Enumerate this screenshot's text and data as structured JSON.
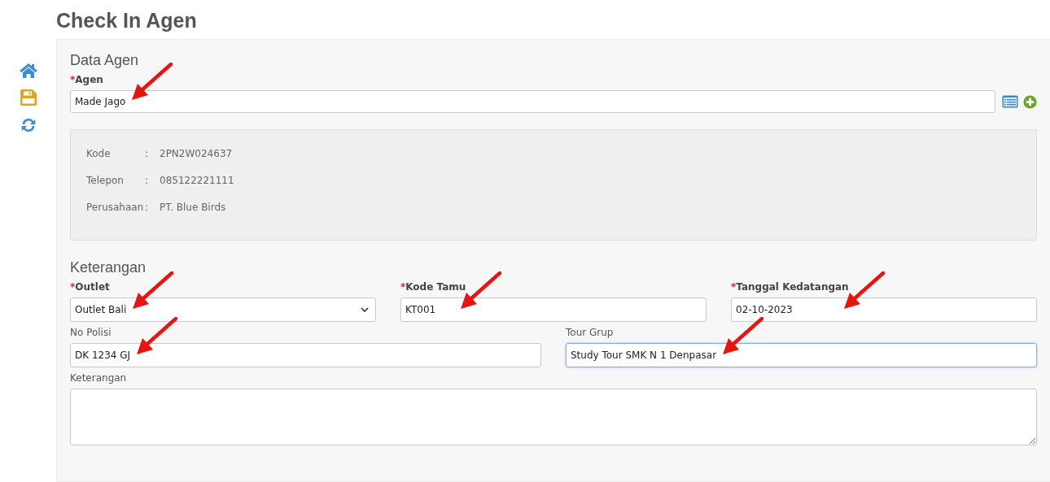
{
  "page_title": "Check In Agen",
  "sidebar": [
    {
      "kind": "home"
    },
    {
      "kind": "save"
    },
    {
      "kind": "refresh"
    }
  ],
  "data_agen": {
    "heading": "Data Agen",
    "agen": {
      "required_mark": "*",
      "label": "Agen",
      "value": "Made Jago",
      "arrow": true
    },
    "info": [
      {
        "label": "Kode",
        "sep": ":",
        "value": "2PN2W024637"
      },
      {
        "label": "Telepon",
        "sep": ":",
        "value": "085122221111"
      },
      {
        "label": "Perusahaan",
        "sep": ":",
        "value": "PT. Blue Birds"
      }
    ]
  },
  "keterangan": {
    "heading": "Keterangan",
    "rows": [
      [
        {
          "kind": "select",
          "required_mark": "*",
          "label": "Outlet",
          "value": "Outlet Bali",
          "arrow": true,
          "focused": false
        },
        {
          "kind": "text",
          "required_mark": "*",
          "label": "Kode Tamu",
          "value": "KT001",
          "arrow": true,
          "focused": false
        },
        {
          "kind": "text",
          "required_mark": "*",
          "label": "Tanggal Kedatangan",
          "value": "02-10-2023",
          "arrow": true,
          "focused": false
        }
      ],
      [
        {
          "kind": "text",
          "label": "No Polisi",
          "value": "DK 1234 GJ",
          "arrow": true,
          "focused": false
        },
        {
          "kind": "text",
          "label": "Tour Grup",
          "value": "Study Tour SMK N 1 Denpasar",
          "arrow": true,
          "focused": true
        }
      ],
      [
        {
          "kind": "textarea",
          "label": "Keterangan",
          "focused": false
        }
      ]
    ]
  }
}
